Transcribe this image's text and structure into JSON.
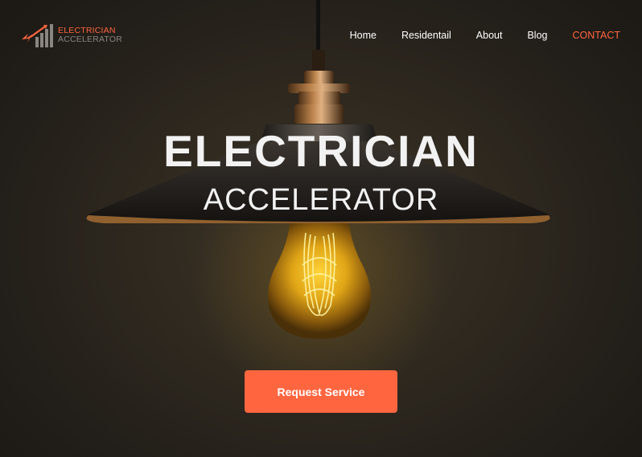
{
  "brand": {
    "line1": "ELECTRICIAN",
    "line2": "ACCELERATOR",
    "logo_icon": "lightning-bar-graph-icon",
    "accent_color": "#ff6640"
  },
  "nav": {
    "items": [
      "Home",
      "Residentail",
      "About",
      "Blog"
    ],
    "contact": "CONTACT"
  },
  "hero": {
    "title": "ELECTRICIAN",
    "subtitle": "ACCELERATOR",
    "background_image": "pendant-lamp-edison-bulb"
  },
  "cta": {
    "label": "Request Service"
  }
}
